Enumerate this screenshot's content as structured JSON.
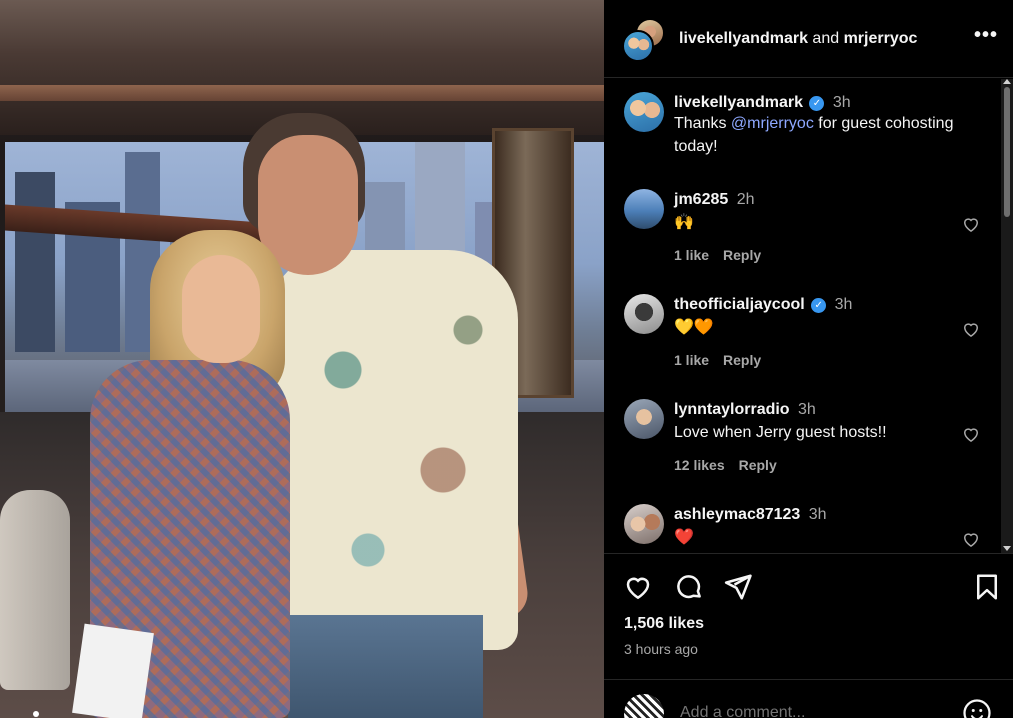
{
  "post": {
    "author": "livekellyandmark",
    "and_text": "and",
    "collaborator": "mrjerryoc",
    "more_label": "•••"
  },
  "caption": {
    "username": "livekellyandmark",
    "time": "3h",
    "text_before": "Thanks ",
    "mention": "@mrjerryoc",
    "text_after": " for guest cohosting today!"
  },
  "comments": [
    {
      "username": "jm6285",
      "verified": false,
      "time": "2h",
      "text": "🙌",
      "likes": "1 like",
      "reply": "Reply"
    },
    {
      "username": "theofficialjaycool",
      "verified": true,
      "time": "3h",
      "text": "💛🧡",
      "likes": "1 like",
      "reply": "Reply"
    },
    {
      "username": "lynntaylorradio",
      "verified": false,
      "time": "3h",
      "text": "Love when Jerry guest hosts!!",
      "likes": "12 likes",
      "reply": "Reply"
    },
    {
      "username": "ashleymac87123",
      "verified": false,
      "time": "3h",
      "text": "❤️",
      "likes": "",
      "reply": ""
    }
  ],
  "stats": {
    "likes": "1,506 likes",
    "posted": "3 hours ago"
  },
  "composer": {
    "placeholder": "Add a comment..."
  },
  "colors": {
    "background": "#000000",
    "secondary_text": "#a8a8a8",
    "mention": "#8ea8ff",
    "verified": "#3897f0"
  }
}
